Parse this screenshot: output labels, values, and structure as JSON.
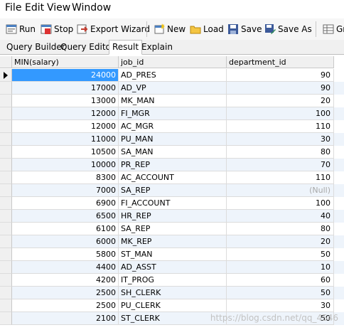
{
  "menu": [
    "File",
    "Edit",
    "View",
    "Window"
  ],
  "toolbar": {
    "run": "Run",
    "stop": "Stop",
    "export": "Export Wizard",
    "new": "New",
    "load": "Load",
    "save": "Save",
    "save_as": "Save As",
    "grid": "Gr"
  },
  "tabs": [
    "Query Builder",
    "Query Editor",
    "Result",
    "Explain"
  ],
  "active_tab": "Result",
  "columns": [
    "MIN(salary)",
    "job_id",
    "department_id"
  ],
  "rows": [
    [
      "24000",
      "AD_PRES",
      "90"
    ],
    [
      "17000",
      "AD_VP",
      "90"
    ],
    [
      "13000",
      "MK_MAN",
      "20"
    ],
    [
      "12000",
      "FI_MGR",
      "100"
    ],
    [
      "12000",
      "AC_MGR",
      "110"
    ],
    [
      "11000",
      "PU_MAN",
      "30"
    ],
    [
      "10500",
      "SA_MAN",
      "80"
    ],
    [
      "10000",
      "PR_REP",
      "70"
    ],
    [
      "8300",
      "AC_ACCOUNT",
      "110"
    ],
    [
      "7000",
      "SA_REP",
      "(Null)"
    ],
    [
      "6900",
      "FI_ACCOUNT",
      "100"
    ],
    [
      "6500",
      "HR_REP",
      "40"
    ],
    [
      "6100",
      "SA_REP",
      "80"
    ],
    [
      "6000",
      "MK_REP",
      "20"
    ],
    [
      "5800",
      "ST_MAN",
      "50"
    ],
    [
      "4400",
      "AD_ASST",
      "10"
    ],
    [
      "4200",
      "IT_PROG",
      "60"
    ],
    [
      "2500",
      "SH_CLERK",
      "50"
    ],
    [
      "2500",
      "PU_CLERK",
      "30"
    ],
    [
      "2100",
      "ST_CLERK",
      "50"
    ]
  ],
  "selected_row": 0,
  "watermark": "https://blog.csdn.net/qq_4546",
  "colors": {
    "selection": "#3399ff",
    "null_text": "#a8a8a8",
    "alt_row": "#eef4fb"
  }
}
